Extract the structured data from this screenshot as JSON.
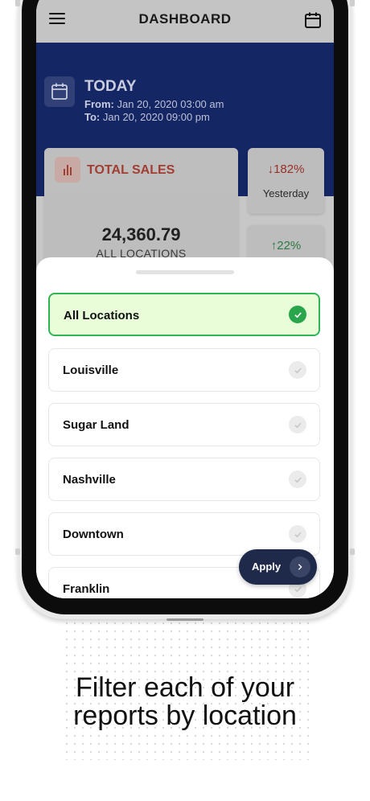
{
  "appbar": {
    "title": "DASHBOARD"
  },
  "today": {
    "title": "TODAY",
    "from_label": "From:",
    "from_value": "Jan 20, 2020 03:00 am",
    "to_label": "To:",
    "to_value": "Jan 20, 2020 09:00 pm"
  },
  "sales": {
    "title": "TOTAL SALES",
    "value": "24,360.79",
    "subtitle": "ALL LOCATIONS"
  },
  "comparison": {
    "yesterday_pct": "182%",
    "yesterday_label": "Yesterday",
    "second_pct": "22%"
  },
  "locations": [
    {
      "label": "All Locations",
      "selected": true
    },
    {
      "label": "Louisville",
      "selected": false
    },
    {
      "label": "Sugar Land",
      "selected": false
    },
    {
      "label": "Nashville",
      "selected": false
    },
    {
      "label": "Downtown",
      "selected": false
    },
    {
      "label": "Franklin",
      "selected": false
    }
  ],
  "apply": {
    "label": "Apply"
  },
  "caption": {
    "line1": "Filter each of your",
    "line2": "reports by location"
  },
  "colors": {
    "accent_blue": "#1b3596",
    "selected_green": "#29a64b",
    "sales_red": "#c0392b",
    "up_green": "#2fa84f",
    "apply_navy": "#1f2a4a"
  },
  "icons": {
    "menu": "hamburger-icon",
    "calendar": "calendar-icon",
    "sales": "bar-chart-icon",
    "check": "check-icon",
    "arrow": "chevron-right-icon"
  }
}
